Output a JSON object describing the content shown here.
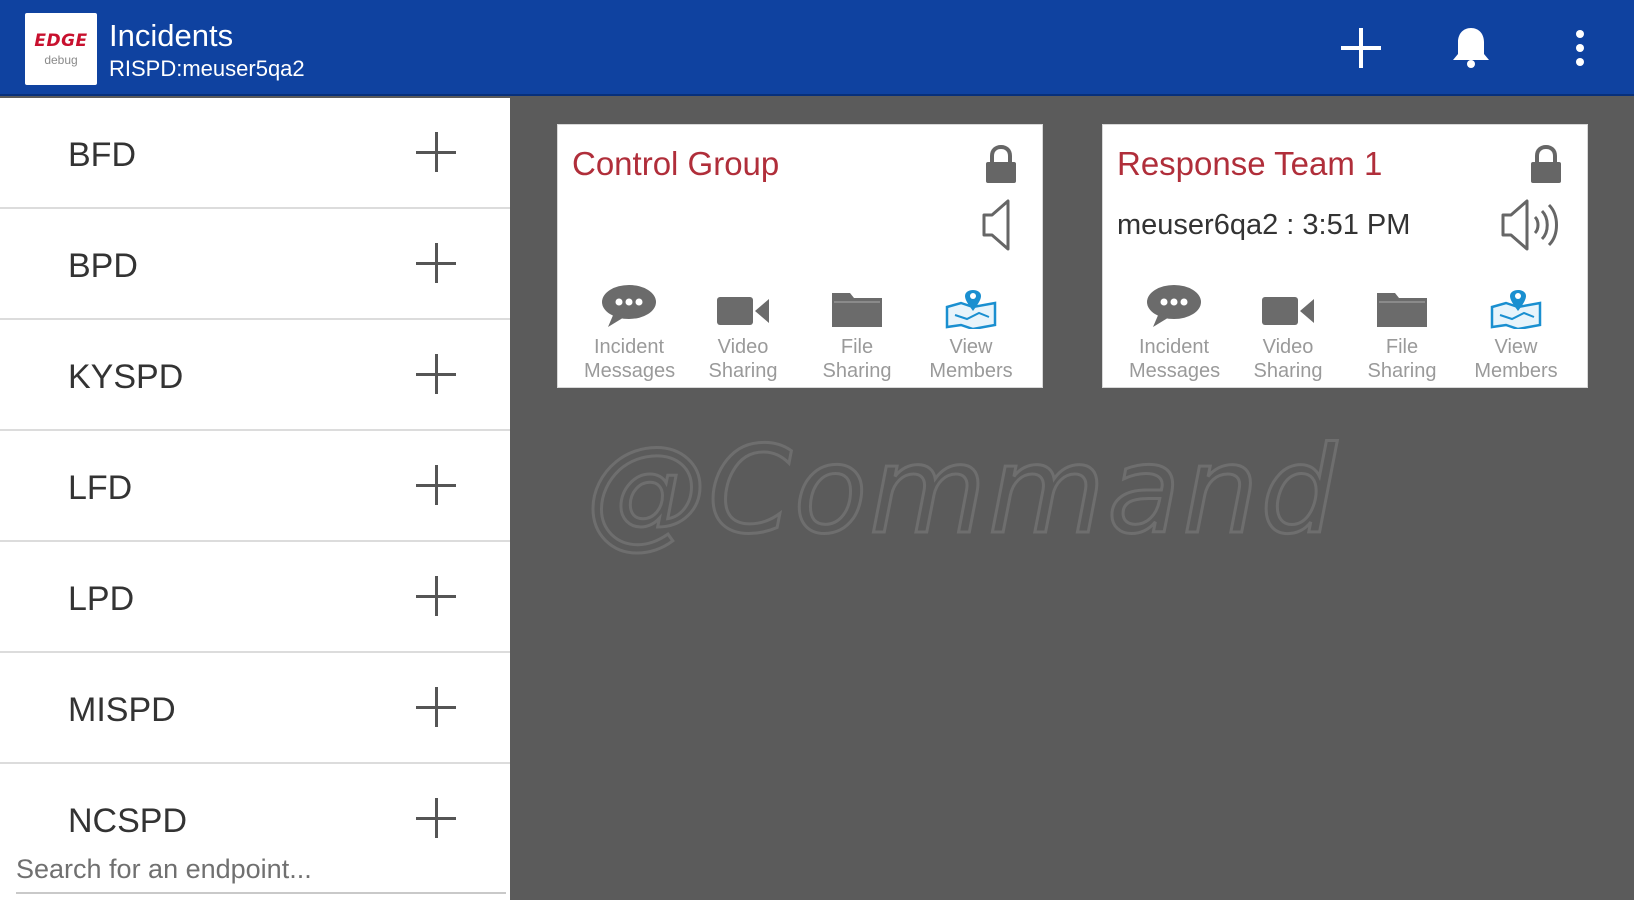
{
  "app": {
    "logo_text": "EDGE",
    "logo_sub": "debug",
    "title": "Incidents",
    "subtitle": "RISPD:meuser5qa2"
  },
  "header_actions": [
    {
      "icon": "add-icon"
    },
    {
      "icon": "bell-icon"
    },
    {
      "icon": "more-vert-icon"
    }
  ],
  "endpoints": [
    {
      "label": "BFD"
    },
    {
      "label": "BPD"
    },
    {
      "label": "KYSPD"
    },
    {
      "label": "LFD"
    },
    {
      "label": "LPD"
    },
    {
      "label": "MISPD"
    },
    {
      "label": "NCSPD"
    }
  ],
  "search": {
    "placeholder": "Search for an endpoint..."
  },
  "groups": [
    {
      "title": "Control Group",
      "status": "",
      "locked": true,
      "speaker": "off",
      "actions": [
        {
          "line1": "Incident",
          "line2": "Messages",
          "icon": "chat-icon"
        },
        {
          "line1": "Video",
          "line2": "Sharing",
          "icon": "video-icon"
        },
        {
          "line1": "File",
          "line2": "Sharing",
          "icon": "folder-icon"
        },
        {
          "line1": "View",
          "line2": "Members",
          "icon": "map-members-icon"
        }
      ]
    },
    {
      "title": "Response Team 1",
      "status": "meuser6qa2 : 3:51 PM",
      "locked": true,
      "speaker": "on",
      "actions": [
        {
          "line1": "Incident",
          "line2": "Messages",
          "icon": "chat-icon"
        },
        {
          "line1": "Video",
          "line2": "Sharing",
          "icon": "video-icon"
        },
        {
          "line1": "File",
          "line2": "Sharing",
          "icon": "folder-icon"
        },
        {
          "line1": "View",
          "line2": "Members",
          "icon": "map-members-icon"
        }
      ]
    }
  ],
  "watermark": "@Command",
  "colors": {
    "header": "#0f42a0",
    "background": "#5b5b5b",
    "group_title": "#b02e3a",
    "map_icon": "#1a8fd0"
  }
}
